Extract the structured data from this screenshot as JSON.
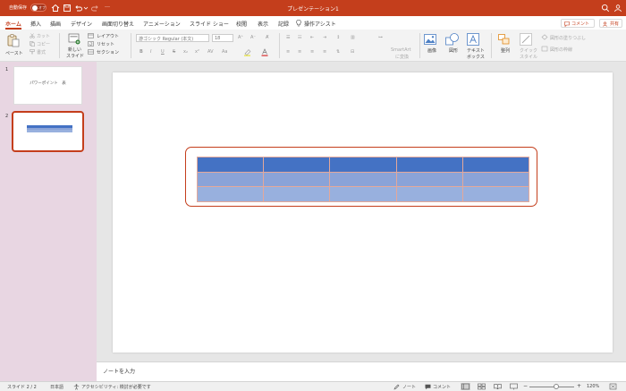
{
  "titlebar": {
    "autosave_label": "自動保存",
    "autosave_state": "オフ",
    "title": "プレゼンテーション1",
    "more": "…"
  },
  "menu": {
    "tabs": [
      "ホーム",
      "挿入",
      "描画",
      "デザイン",
      "画面切り替え",
      "アニメーション",
      "スライド ショー",
      "校閲",
      "表示",
      "記録",
      "操作アシスト"
    ],
    "comment_btn": "コメント",
    "share_btn": "共有"
  },
  "ribbon": {
    "paste": "ペースト",
    "cut": "カット",
    "copy": "コピー",
    "format": "書式",
    "new_slide_1": "新しい",
    "new_slide_2": "スライド",
    "layout": "レイアウト",
    "reset": "リセット",
    "section": "セクション",
    "font_name": "游ゴシック Regular (本文)",
    "font_size": "18",
    "smartart_1": "SmartArt",
    "smartart_2": "に変換",
    "image": "画像",
    "shape": "図形",
    "textbox_1": "テキスト",
    "textbox_2": "ボックス",
    "arrange": "整列",
    "quickstyle_1": "クイック",
    "quickstyle_2": "スタイル",
    "shape_fill": "図形の塗りつぶし",
    "shape_outline": "図形の枠線"
  },
  "slides": {
    "items": [
      {
        "number": "1",
        "title": "パワーポイント　表"
      },
      {
        "number": "2",
        "title": ""
      }
    ]
  },
  "table": {
    "rows": 3,
    "cols": 5
  },
  "notes": {
    "placeholder": "ノートを入力"
  },
  "status": {
    "slide_indicator": "スライド 2 / 2",
    "language": "日本語",
    "accessibility": "アクセシビリティ: 検討が必要です",
    "notes_btn": "ノート",
    "comments_btn": "コメント",
    "zoom": "120%",
    "zoom_minus": "−",
    "zoom_plus": "+"
  },
  "colors": {
    "accent": "#c43e1c",
    "table_header": "#4472c4",
    "table_band_1": "#8aa3d8",
    "table_band_2": "#98b0de",
    "slide_pane": "#e8d6e2"
  }
}
